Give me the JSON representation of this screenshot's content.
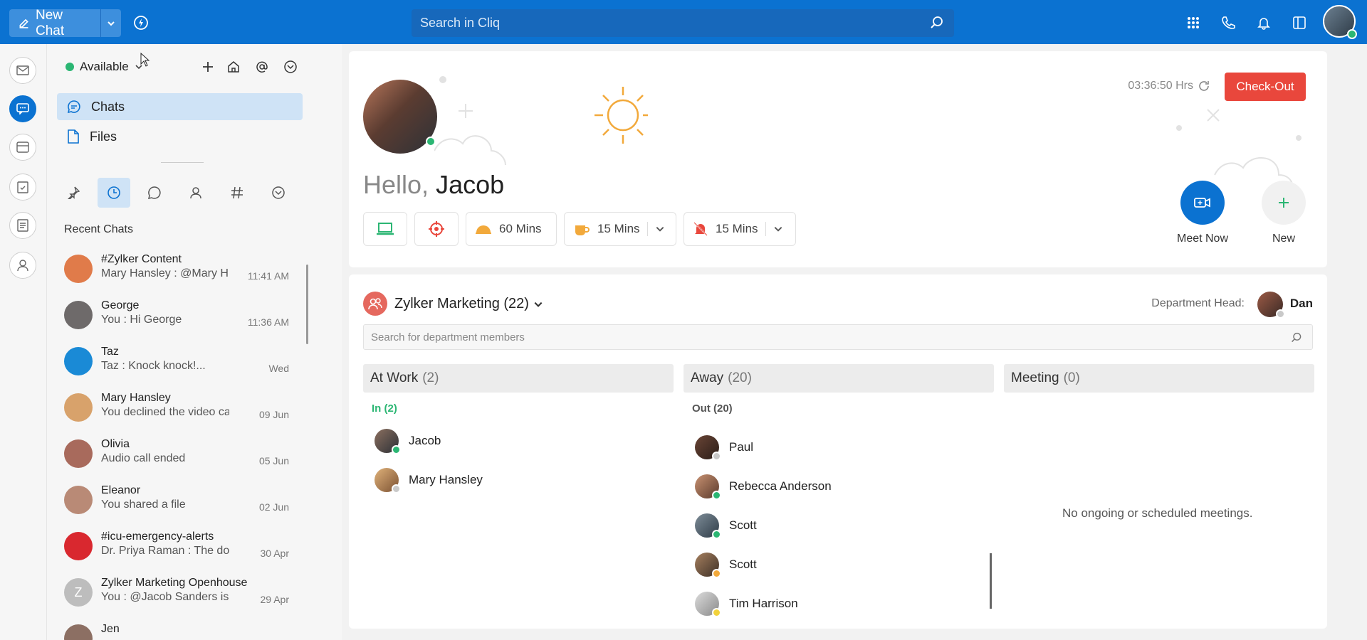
{
  "topbar": {
    "new_chat_label": "New Chat",
    "search_placeholder": "Search in Cliq"
  },
  "sidebar": {
    "status": "Available",
    "nav": [
      {
        "label": "Chats",
        "icon": "chat-icon"
      },
      {
        "label": "Files",
        "icon": "file-icon"
      }
    ],
    "recent_title": "Recent Chats",
    "chats": [
      {
        "name": "#Zylker Content",
        "msg": "Mary Hansley : @Mary H...",
        "time": "11:41 AM",
        "color": "#e07b4a"
      },
      {
        "name": "George",
        "msg": "You : Hi George",
        "time": "11:36 AM",
        "color": "#6e6a6a"
      },
      {
        "name": "Taz",
        "msg": "Taz : Knock knock!...",
        "time": "Wed",
        "color": "#1a8ad6"
      },
      {
        "name": "Mary Hansley",
        "msg": "You declined the video call",
        "time": "09 Jun",
        "color": "#d8a26b"
      },
      {
        "name": "Olivia",
        "msg": "Audio call ended",
        "time": "05 Jun",
        "color": "#a86a5c"
      },
      {
        "name": "Eleanor",
        "msg": "You shared a file",
        "time": "02 Jun",
        "color": "#b98a76"
      },
      {
        "name": "#icu-emergency-alerts",
        "msg": "Dr. Priya Raman : The doc...",
        "time": "30 Apr",
        "color": "#d9282f"
      },
      {
        "name": "Zylker Marketing Openhouse",
        "msg": "You : @Jacob Sanders  is i...",
        "time": "29 Apr",
        "color": "#bdbdbd",
        "initial": "Z"
      },
      {
        "name": "Jen",
        "msg": "",
        "time": "",
        "color": "#8c6f63"
      }
    ]
  },
  "welcome": {
    "hello": "Hello,",
    "name": "Jacob",
    "timer": "03:36:50 Hrs",
    "checkout": "Check-Out",
    "chips": [
      {
        "label": "",
        "icon": "laptop-icon"
      },
      {
        "label": "",
        "icon": "target-icon"
      },
      {
        "label": "60 Mins",
        "icon": "lunch-icon"
      },
      {
        "label": "15 Mins",
        "icon": "coffee-icon"
      },
      {
        "label": "15 Mins",
        "icon": "do-not-disturb-icon"
      }
    ],
    "meet_now": "Meet Now",
    "new_label": "New"
  },
  "department": {
    "title": "Zylker Marketing (22)",
    "head_label": "Department Head:",
    "head_name": "Dan",
    "search_placeholder": "Search for department members",
    "columns": [
      {
        "title": "At Work",
        "count": "(2)"
      },
      {
        "title": "Away",
        "count": "(20)"
      },
      {
        "title": "Meeting",
        "count": "(0)"
      }
    ],
    "at_work_sub": "In (2)",
    "away_sub": "Out (20)",
    "at_work_members": [
      "Jacob",
      "Mary  Hansley"
    ],
    "away_members": [
      "Paul",
      "Rebecca Anderson",
      "Scott",
      "Scott",
      "Tim Harrison"
    ],
    "no_meetings": "No ongoing or scheduled meetings."
  },
  "colors": {
    "brand": "#0b72d1",
    "checkout": "#e9473c",
    "online": "#2bb673"
  }
}
